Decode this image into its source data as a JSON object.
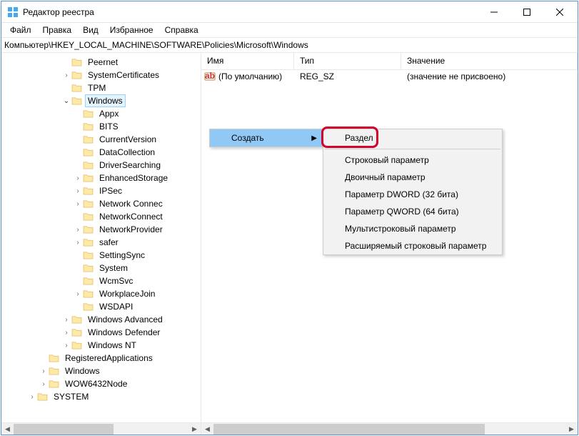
{
  "window": {
    "title": "Редактор реестра"
  },
  "menu": {
    "file": "Файл",
    "edit": "Правка",
    "view": "Вид",
    "fav": "Избранное",
    "help": "Справка"
  },
  "address": "Компьютер\\HKEY_LOCAL_MACHINE\\SOFTWARE\\Policies\\Microsoft\\Windows",
  "columns": {
    "name": "Имя",
    "type": "Тип",
    "value": "Значение"
  },
  "row": {
    "name": "(По умолчанию)",
    "type": "REG_SZ",
    "value": "(значение не присвоено)"
  },
  "tree": [
    {
      "indent": 5,
      "exp": "",
      "label": "Peernet"
    },
    {
      "indent": 5,
      "exp": ">",
      "label": "SystemCertificates"
    },
    {
      "indent": 5,
      "exp": "",
      "label": "TPM"
    },
    {
      "indent": 5,
      "exp": "v",
      "label": "Windows",
      "selected": true
    },
    {
      "indent": 6,
      "exp": "",
      "label": "Appx"
    },
    {
      "indent": 6,
      "exp": "",
      "label": "BITS"
    },
    {
      "indent": 6,
      "exp": "",
      "label": "CurrentVersion"
    },
    {
      "indent": 6,
      "exp": "",
      "label": "DataCollection"
    },
    {
      "indent": 6,
      "exp": "",
      "label": "DriverSearching"
    },
    {
      "indent": 6,
      "exp": ">",
      "label": "EnhancedStorage"
    },
    {
      "indent": 6,
      "exp": ">",
      "label": "IPSec"
    },
    {
      "indent": 6,
      "exp": ">",
      "label": "Network Connec"
    },
    {
      "indent": 6,
      "exp": "",
      "label": "NetworkConnect"
    },
    {
      "indent": 6,
      "exp": ">",
      "label": "NetworkProvider"
    },
    {
      "indent": 6,
      "exp": ">",
      "label": "safer"
    },
    {
      "indent": 6,
      "exp": "",
      "label": "SettingSync"
    },
    {
      "indent": 6,
      "exp": "",
      "label": "System"
    },
    {
      "indent": 6,
      "exp": "",
      "label": "WcmSvc"
    },
    {
      "indent": 6,
      "exp": ">",
      "label": "WorkplaceJoin"
    },
    {
      "indent": 6,
      "exp": "",
      "label": "WSDAPI"
    },
    {
      "indent": 5,
      "exp": ">",
      "label": "Windows Advanced"
    },
    {
      "indent": 5,
      "exp": ">",
      "label": "Windows Defender"
    },
    {
      "indent": 5,
      "exp": ">",
      "label": "Windows NT"
    },
    {
      "indent": 3,
      "exp": "",
      "label": "RegisteredApplications"
    },
    {
      "indent": 3,
      "exp": ">",
      "label": "Windows"
    },
    {
      "indent": 3,
      "exp": ">",
      "label": "WOW6432Node"
    },
    {
      "indent": 2,
      "exp": ">",
      "label": "SYSTEM"
    }
  ],
  "ctx1": {
    "create": "Создать"
  },
  "ctx2": {
    "section": "Раздел",
    "string": "Строковый параметр",
    "binary": "Двоичный параметр",
    "dword": "Параметр DWORD (32 бита)",
    "qword": "Параметр QWORD (64 бита)",
    "multi": "Мультистроковый параметр",
    "expand": "Расширяемый строковый параметр"
  }
}
